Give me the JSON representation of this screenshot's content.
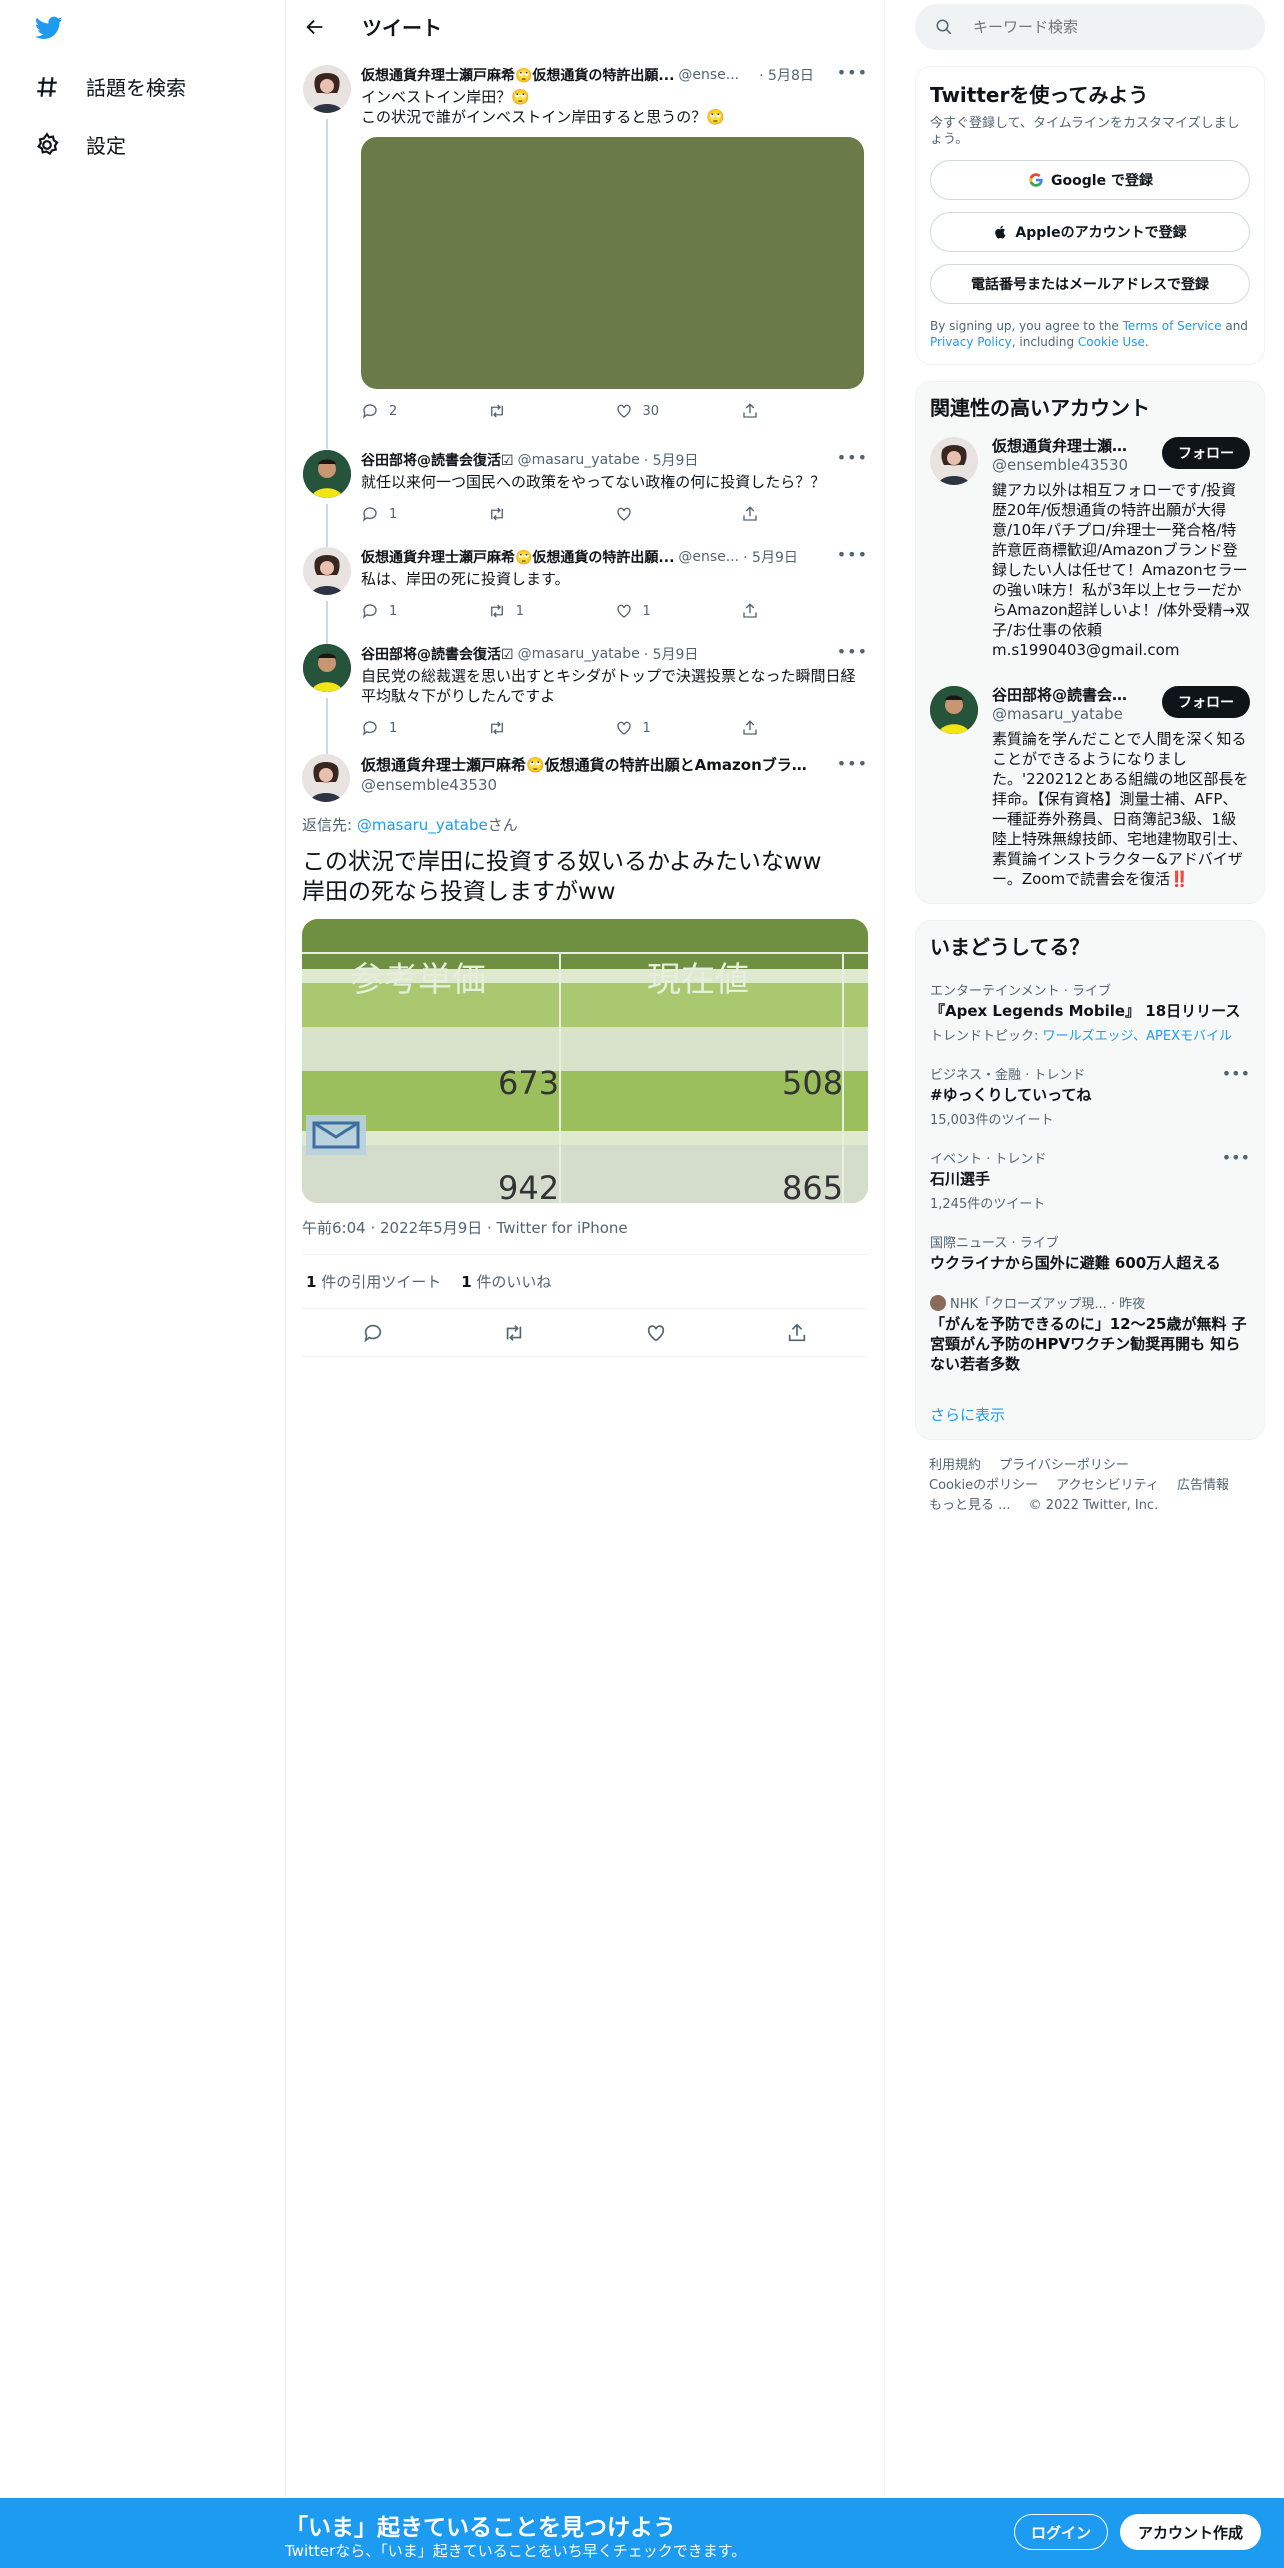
{
  "nav": {
    "explore_label": "話題を検索",
    "settings_label": "設定"
  },
  "header": {
    "title": "ツイート"
  },
  "thread": [
    {
      "name": "仮想通貨弁理士瀬戸麻希🙄仮想通貨の特許出願...",
      "handle": "@ense...",
      "date": "· 5月8日",
      "text": "インベストイン岸田？🙄\nこの状況で誰がインベストイン岸田すると思うの？🙄",
      "replies": "2",
      "retweets": "",
      "likes": "30"
    },
    {
      "name": "谷田部将@読書会復活☑",
      "handle": "@masaru_yatabe",
      "date": "· 5月9日",
      "text": "就任以来何一つ国民への政策をやってない政権の何に投資したら？？",
      "replies": "1",
      "retweets": "",
      "likes": ""
    },
    {
      "name": "仮想通貨弁理士瀬戸麻希🙄仮想通貨の特許出願...",
      "handle": "@ense...",
      "date": "· 5月9日",
      "text": "私は、岸田の死に投資します。",
      "replies": "1",
      "retweets": "1",
      "likes": "1"
    },
    {
      "name": "谷田部将@読書会復活☑",
      "handle": "@masaru_yatabe",
      "date": "· 5月9日",
      "text": "自民党の総裁選を思い出すとキシダがトップで決選投票となった瞬間日経平均駄々下がりしたんですよ",
      "replies": "1",
      "retweets": "",
      "likes": "1"
    }
  ],
  "main_tweet": {
    "name": "仮想通貨弁理士瀬戸麻希🙄仮想通貨の特許出願とAmazonブランド...",
    "handle": "@ensemble43530",
    "reply_prefix": "返信先: ",
    "reply_to": "@masaru_yatabe",
    "reply_suffix": "さん",
    "text": "この状況で岸田に投資する奴いるかよみたいなww\n岸田の死なら投資しますがww",
    "image": {
      "header_left": "参考単価",
      "header_right": "現在値",
      "row1_left": "673",
      "row1_right": "508",
      "row2_left": "942",
      "row2_right": "865"
    },
    "meta": "午前6:04 · 2022年5月9日 · Twitter for iPhone",
    "quote_count": "1",
    "quote_label": " 件の引用ツイート",
    "like_count": "1",
    "like_label": " 件のいいね"
  },
  "search": {
    "placeholder": "キーワード検索"
  },
  "signup_card": {
    "title": "Twitterを使ってみよう",
    "subtitle": "今すぐ登録して、タイムラインをカスタマイズしましょう。",
    "google_label": "Google で登録",
    "apple_label": "Appleのアカウントで登録",
    "phone_label": "電話番号またはメールアドレスで登録",
    "terms_prefix": "By signing up, you agree to the ",
    "terms_link": "Terms of Service",
    "terms_and": " and ",
    "privacy_link": "Privacy Policy",
    "terms_including": ", including ",
    "cookie_link": "Cookie Use",
    "terms_end": "."
  },
  "who_to_follow": {
    "title": "関連性の高いアカウント",
    "follow_label": "フォロー",
    "accounts": [
      {
        "name": "仮想通貨弁理士瀬戸...",
        "handle": "@ensemble43530",
        "bio": "鍵アカ以外は相互フォローです/投資歴20年/仮想通貨の特許出願が大得意/10年パチプロ/弁理士一発合格/特許意匠商標歓迎/Amazonブランド登録したい人は任せて！Amazonセラーの強い味方！私が3年以上セラーだからAmazon超詳しいよ！/体外受精→双子/お仕事の依頼m.s1990403@gmail.com"
      },
      {
        "name": "谷田部将@読書会復...",
        "handle": "@masaru_yatabe",
        "bio": "素質論を学んだことで人間を深く知ることができるようになりました。'220212とある組織の地区部長を拝命。【保有資格】測量士補、AFP、一種証券外務員、日商簿記3級、1級陸上特殊無線技師、宅地建物取引士、素質論インストラクター&アドバイザー。Zoomで読書会を復活‼️"
      }
    ]
  },
  "trends": {
    "title": "いまどうしてる？",
    "items": [
      {
        "category": "エンターテインメント · ライブ",
        "name": "『Apex Legends Mobile』 18日リリース",
        "sub_prefix": "トレンドトピック: ",
        "sub_link": "ワールズエッジ、APEXモバイル"
      },
      {
        "category": "ビジネス・金融 · トレンド",
        "name": "#ゆっくりしていってね",
        "sub": "15,003件のツイート"
      },
      {
        "category": "イベント · トレンド",
        "name": "石川選手",
        "sub": "1,245件のツイート"
      },
      {
        "category": "国際ニュース · ライブ",
        "name": "ウクライナから国外に避難 600万人超える"
      },
      {
        "category": "NHK「クローズアップ現... · 昨夜",
        "name": "「がんを予防できるのに」12～25歳が無料 子宮頸がん予防のHPVワクチン勧奨再開も 知らない若者多数"
      }
    ],
    "show_more": "さらに表示"
  },
  "footer": {
    "links": [
      "利用規約",
      "プライバシーポリシー",
      "Cookieのポリシー",
      "アクセシビリティ",
      "広告情報",
      "もっと見る ...",
      "© 2022 Twitter, Inc."
    ]
  },
  "bottom_bar": {
    "title": "「いま」起きていることを見つけよう",
    "subtitle": "Twitterなら、「いま」起きていることをいち早くチェックできます。",
    "login_label": "ログイン",
    "signup_label": "アカウント作成"
  },
  "colors": {
    "accent": "#1d9bf0",
    "text": "#0f1419",
    "muted": "#536471"
  }
}
